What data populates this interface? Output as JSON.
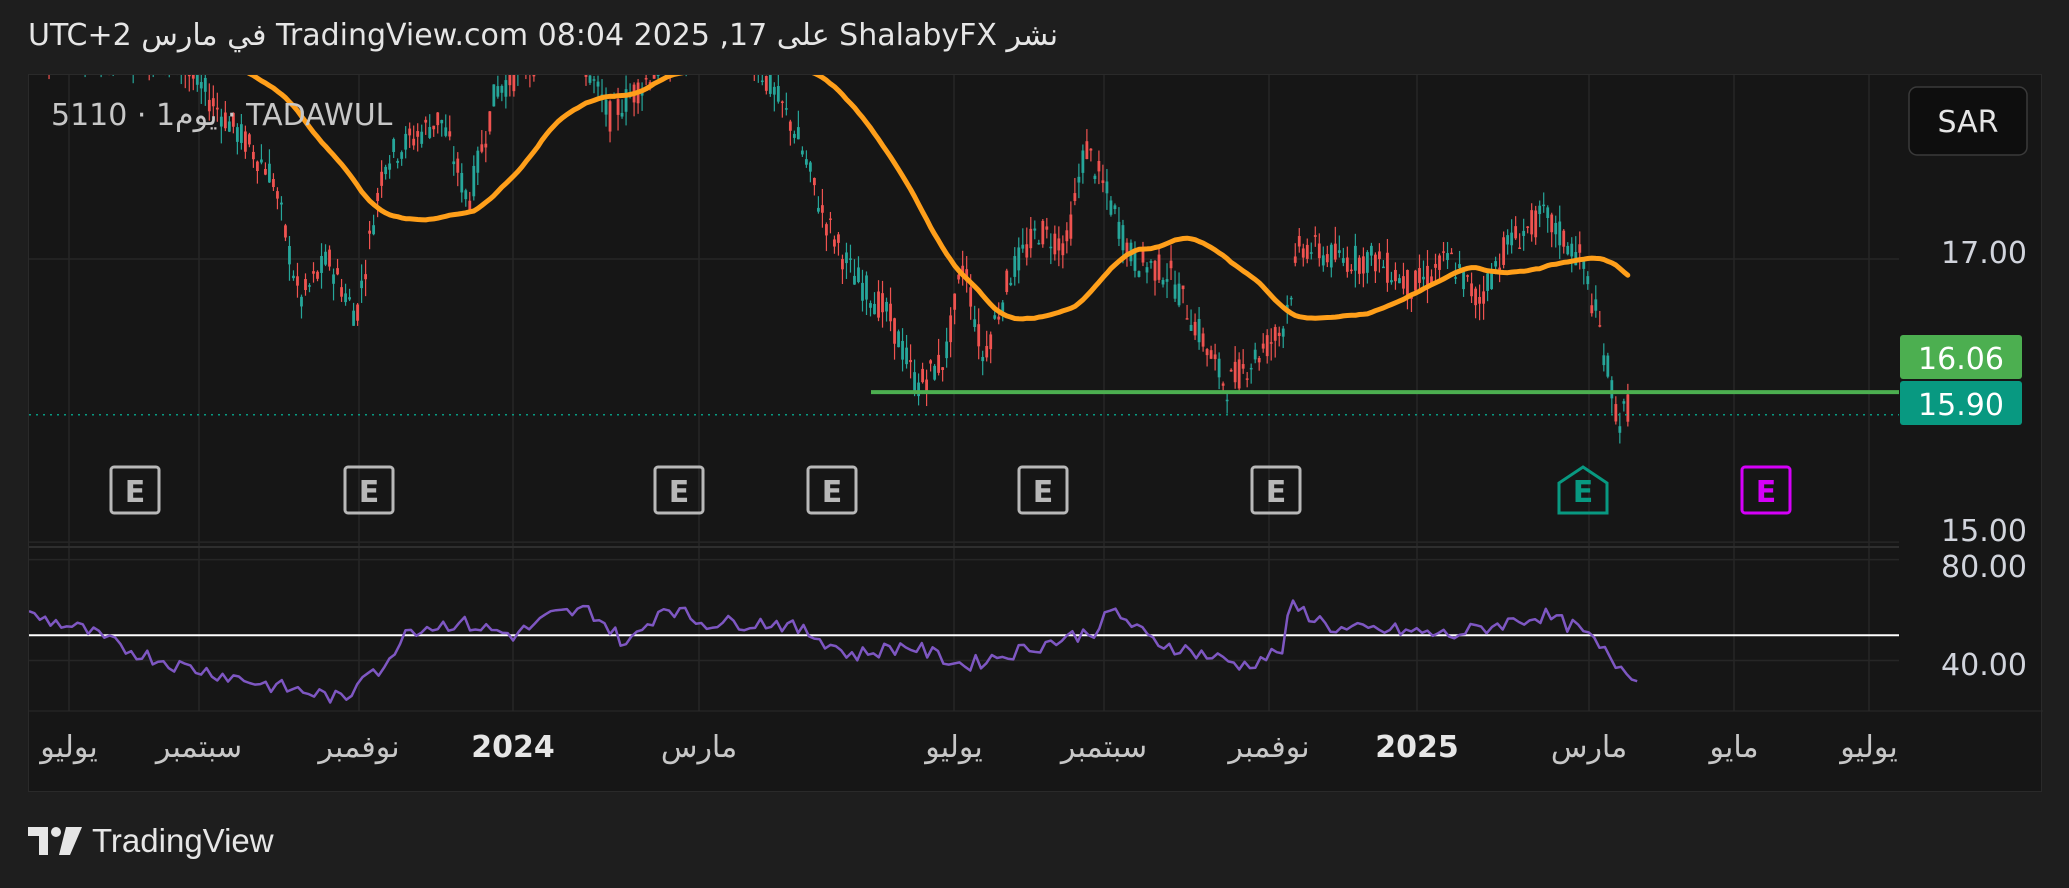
{
  "header": {
    "text": "نشر ShalabyFX على TradingView.com 08:04 2025 ,17 في مارس UTC+2"
  },
  "symbol": {
    "label": "5110 · 1يوم · TADAWUL"
  },
  "currency_button": {
    "label": "SAR"
  },
  "footer": {
    "brand": "TradingView"
  },
  "colors": {
    "up_candle": "#26a69a",
    "down_candle": "#ef5350",
    "moving_average": "#ff9f1a",
    "support_line": "#4caf50",
    "rsi_line": "#7e57c2",
    "last_price_badge": "#089981",
    "support_badge": "#4caf50",
    "earnings_future": "#d500f9",
    "earnings_recent": "#089981"
  },
  "chart_data": [
    {
      "type": "candlestick",
      "title": "",
      "price_axis": {
        "ticks": [
          "17.00",
          "15.00"
        ],
        "ylim": [
          14.98,
          18.3
        ]
      },
      "time_axis": {
        "ticks": [
          "يوليو",
          "سبتمبر",
          "نوفمبر",
          "2024",
          "مارس",
          "يوليو",
          "سبتمبر",
          "نوفمبر",
          "2025",
          "مارس",
          "مايو",
          "يوليو"
        ]
      },
      "badges": {
        "support_price": "16.06",
        "last_price": "15.90"
      },
      "support_level": 16.06,
      "last_price": 15.9,
      "earnings_markers": [
        {
          "label": "E",
          "state": "past"
        },
        {
          "label": "E",
          "state": "past"
        },
        {
          "label": "E",
          "state": "past"
        },
        {
          "label": "E",
          "state": "past"
        },
        {
          "label": "E",
          "state": "past"
        },
        {
          "label": "E",
          "state": "past"
        },
        {
          "label": "E",
          "state": "recent"
        },
        {
          "label": "E",
          "state": "upcoming"
        }
      ],
      "price_path": [
        [
          0,
          18.5
        ],
        [
          0.08,
          18.4
        ],
        [
          0.13,
          17.6
        ],
        [
          0.145,
          16.7
        ],
        [
          0.16,
          17.0
        ],
        [
          0.175,
          16.6
        ],
        [
          0.19,
          17.7
        ],
        [
          0.22,
          18.0
        ],
        [
          0.235,
          17.4
        ],
        [
          0.25,
          18.2
        ],
        [
          0.27,
          18.4
        ],
        [
          0.29,
          18.6
        ],
        [
          0.31,
          18.0
        ],
        [
          0.34,
          18.4
        ],
        [
          0.38,
          18.6
        ],
        [
          0.41,
          17.9
        ],
        [
          0.425,
          17.3
        ],
        [
          0.44,
          16.9
        ],
        [
          0.46,
          16.6
        ],
        [
          0.475,
          16.1
        ],
        [
          0.49,
          16.3
        ],
        [
          0.5,
          17.0
        ],
        [
          0.51,
          16.3
        ],
        [
          0.525,
          16.9
        ],
        [
          0.54,
          17.2
        ],
        [
          0.555,
          17.1
        ],
        [
          0.565,
          17.8
        ],
        [
          0.575,
          17.5
        ],
        [
          0.59,
          17.0
        ],
        [
          0.61,
          16.9
        ],
        [
          0.625,
          16.5
        ],
        [
          0.64,
          16.1
        ],
        [
          0.655,
          16.3
        ],
        [
          0.67,
          16.5
        ],
        [
          0.68,
          17.1
        ],
        [
          0.7,
          17.0
        ],
        [
          0.72,
          17.0
        ],
        [
          0.74,
          16.8
        ],
        [
          0.76,
          17.0
        ],
        [
          0.775,
          16.7
        ],
        [
          0.79,
          17.1
        ],
        [
          0.81,
          17.3
        ],
        [
          0.83,
          17.0
        ],
        [
          0.84,
          16.5
        ],
        [
          0.85,
          15.85
        ],
        [
          0.855,
          15.95
        ]
      ]
    },
    {
      "type": "line",
      "name_shown": "",
      "axis": {
        "ticks": [
          "80.00",
          "40.00"
        ],
        "ylim": [
          20,
          85
        ]
      },
      "reference_level": 50,
      "rsi_path": [
        [
          0,
          58
        ],
        [
          0.03,
          52
        ],
        [
          0.05,
          45
        ],
        [
          0.08,
          38
        ],
        [
          0.1,
          35
        ],
        [
          0.13,
          30
        ],
        [
          0.16,
          26
        ],
        [
          0.17,
          24
        ],
        [
          0.18,
          38
        ],
        [
          0.19,
          35
        ],
        [
          0.2,
          52
        ],
        [
          0.23,
          55
        ],
        [
          0.26,
          50
        ],
        [
          0.28,
          58
        ],
        [
          0.3,
          60
        ],
        [
          0.32,
          46
        ],
        [
          0.34,
          62
        ],
        [
          0.36,
          55
        ],
        [
          0.4,
          55
        ],
        [
          0.42,
          50
        ],
        [
          0.44,
          42
        ],
        [
          0.47,
          46
        ],
        [
          0.5,
          38
        ],
        [
          0.52,
          42
        ],
        [
          0.55,
          48
        ],
        [
          0.57,
          52
        ],
        [
          0.58,
          60
        ],
        [
          0.6,
          48
        ],
        [
          0.63,
          42
        ],
        [
          0.65,
          38
        ],
        [
          0.67,
          44
        ],
        [
          0.675,
          62
        ],
        [
          0.7,
          52
        ],
        [
          0.73,
          52
        ],
        [
          0.76,
          50
        ],
        [
          0.79,
          55
        ],
        [
          0.81,
          58
        ],
        [
          0.83,
          52
        ],
        [
          0.85,
          38
        ],
        [
          0.86,
          34
        ]
      ]
    }
  ]
}
